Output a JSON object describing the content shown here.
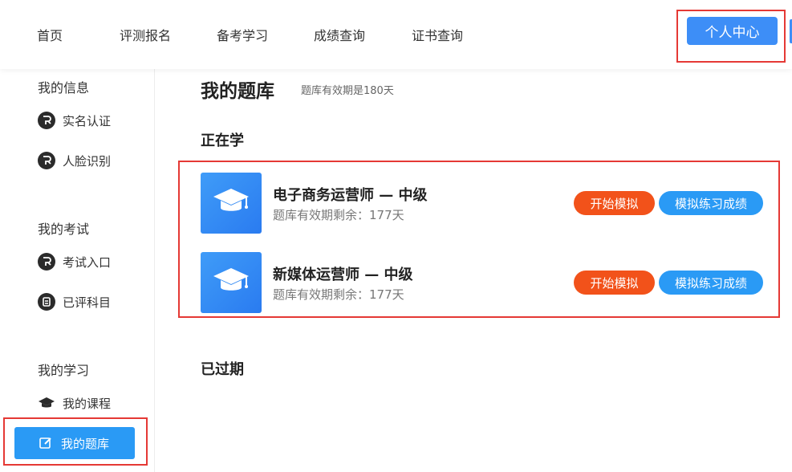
{
  "nav": {
    "items": [
      "首页",
      "评测报名",
      "备考学习",
      "成绩查询",
      "证书查询"
    ],
    "profile_button": "个人中心"
  },
  "sidebar": {
    "sections": [
      {
        "heading": "我的信息",
        "items": [
          {
            "label": "实名认证",
            "icon": "id-badge-icon"
          },
          {
            "label": "人脸识别",
            "icon": "face-id-icon"
          }
        ]
      },
      {
        "heading": "我的考试",
        "items": [
          {
            "label": "考试入口",
            "icon": "exam-entry-icon"
          },
          {
            "label": "已评科目",
            "icon": "graded-subject-icon"
          }
        ]
      },
      {
        "heading": "我的学习",
        "items": [
          {
            "label": "我的课程",
            "icon": "graduation-cap-icon"
          },
          {
            "label": "我的题库",
            "icon": "edit-note-icon",
            "active": true
          }
        ]
      }
    ]
  },
  "main": {
    "title": "我的题库",
    "validity_note": "题库有效期是180天",
    "learning_heading": "正在学",
    "expired_heading": "已过期",
    "banks": [
      {
        "name": "电子商务运营师 — 中级",
        "remaining": "题库有效期剩余：177天",
        "start_label": "开始模拟",
        "score_label": "模拟练习成绩"
      },
      {
        "name": "新媒体运营师 — 中级",
        "remaining": "题库有效期剩余：177天",
        "start_label": "开始模拟",
        "score_label": "模拟练习成绩"
      }
    ]
  },
  "colors": {
    "accent_blue": "#2a9af5",
    "profile_blue": "#3d8ef7",
    "start_orange": "#f2521a",
    "highlight_red": "#e53935"
  }
}
